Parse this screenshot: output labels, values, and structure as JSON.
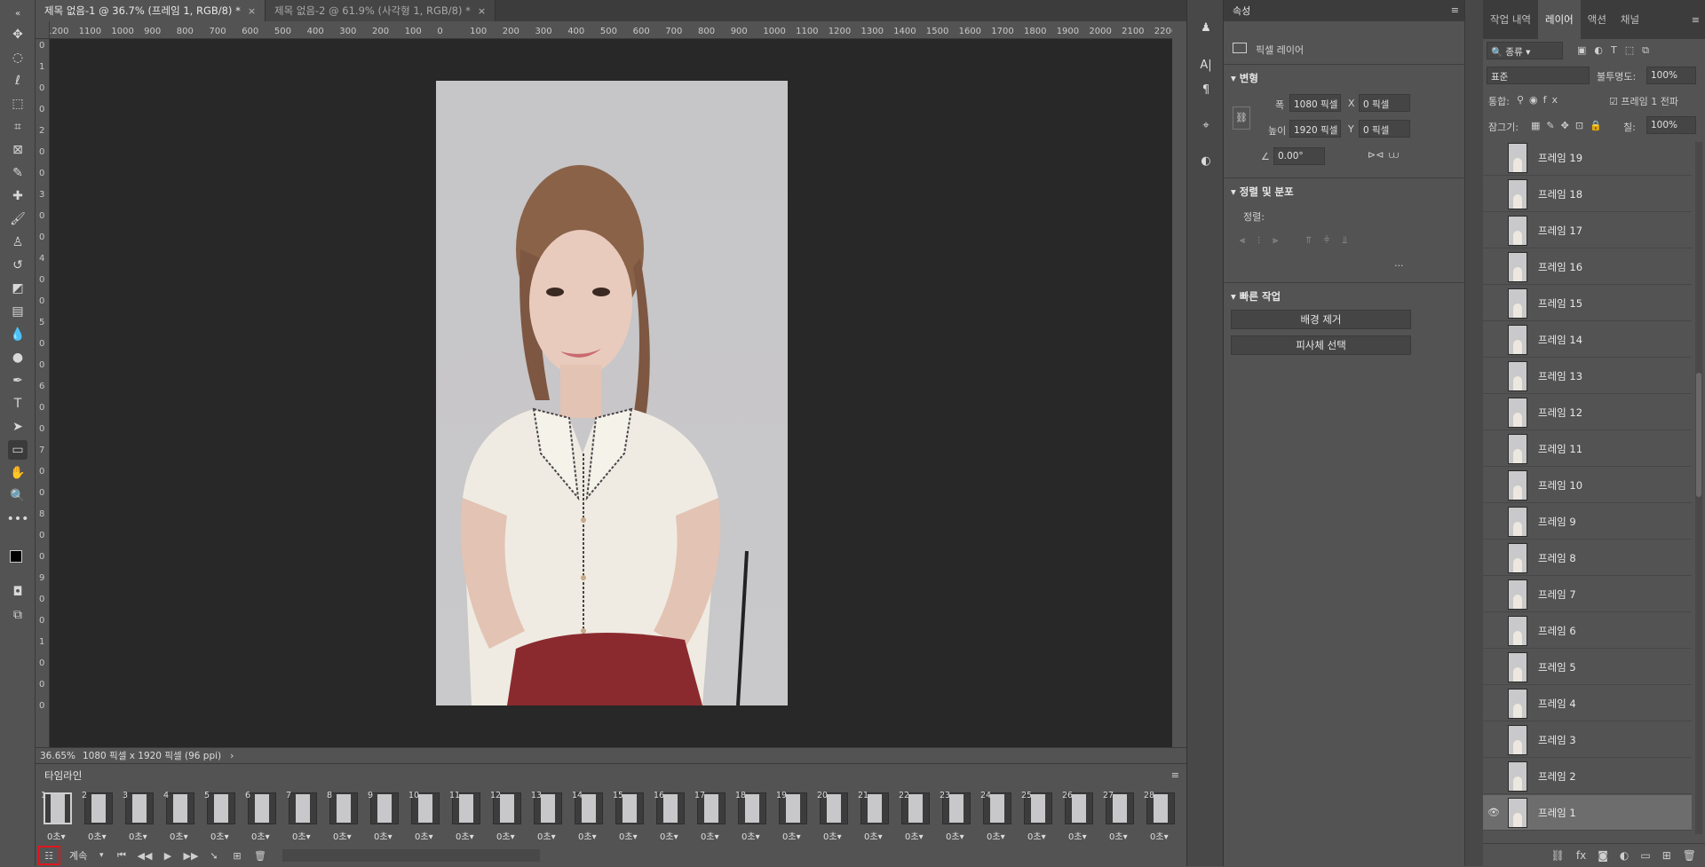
{
  "documents": {
    "tabs": [
      {
        "label": "제목 없음-1 @ 36.7% (프레임 1, RGB/8) *",
        "close": "×"
      },
      {
        "label": "제목 없음-2 @ 61.9% (사각형 1, RGB/8) *",
        "close": "×"
      }
    ]
  },
  "ruler": {
    "h_ticks": [
      "1200",
      "1100",
      "1000",
      "900",
      "800",
      "700",
      "600",
      "500",
      "400",
      "300",
      "200",
      "100",
      "0",
      "100",
      "200",
      "300",
      "400",
      "500",
      "600",
      "700",
      "800",
      "900",
      "1000",
      "1100",
      "1200",
      "1300",
      "1400",
      "1500",
      "1600",
      "1700",
      "1800",
      "1900",
      "2000",
      "2100",
      "2200"
    ],
    "v_ticks": [
      "0",
      "1",
      "0",
      "0",
      "2",
      "0",
      "0",
      "3",
      "0",
      "0",
      "4",
      "0",
      "0",
      "5",
      "0",
      "0",
      "6",
      "0",
      "0",
      "7",
      "0",
      "0",
      "8",
      "0",
      "0",
      "9",
      "0",
      "0",
      "1",
      "0",
      "0",
      "0"
    ]
  },
  "status": {
    "zoom": "36.65%",
    "info": "1080 픽셀 x 1920 픽셀 (96 ppi)",
    "arrow": "›"
  },
  "timeline": {
    "title": "타임라인",
    "frames": [
      "1",
      "2",
      "3",
      "4",
      "5",
      "6",
      "7",
      "8",
      "9",
      "10",
      "11",
      "12",
      "13",
      "14",
      "15",
      "16",
      "17",
      "18",
      "19",
      "20",
      "21",
      "22",
      "23",
      "24",
      "25",
      "26",
      "27",
      "28"
    ],
    "delay": "0초",
    "loop": "계속",
    "selected_frame": "1"
  },
  "properties": {
    "tab": "속성",
    "layer_type": "픽셀 레이어",
    "transform": {
      "title": "변형",
      "width_label": "폭",
      "width": "1080 픽셀",
      "height_label": "높이",
      "height": "1920 픽셀",
      "x_label": "X",
      "x": "0 픽셀",
      "y_label": "Y",
      "y": "0 픽셀",
      "angle": "0.00°"
    },
    "align": {
      "title": "정렬 및 분포",
      "label": "정렬:",
      "more": "..."
    },
    "quick": {
      "title": "빠른 작업",
      "remove_bg": "배경 제거",
      "select_subject": "피사체 선택"
    }
  },
  "layers_panel": {
    "tabs": [
      "작업 내역",
      "레이어",
      "액션",
      "채널"
    ],
    "active_tab": "레이어",
    "filter_kind": "종류",
    "blend_mode": "표준",
    "opacity_label": "불투명도:",
    "opacity": "100%",
    "unify_label": "통합:",
    "propagate": "프레임 1 전파",
    "lock_label": "잠그기:",
    "fill_label": "칠:",
    "fill": "100%",
    "layers": [
      "프레임 19",
      "프레임 18",
      "프레임 17",
      "프레임 16",
      "프레임 15",
      "프레임 14",
      "프레임 13",
      "프레임 12",
      "프레임 11",
      "프레임 10",
      "프레임 9",
      "프레임 8",
      "프레임 7",
      "프레임 6",
      "프레임 5",
      "프레임 4",
      "프레임 3",
      "프레임 2",
      "프레임 1"
    ],
    "active_layer": "프레임 1"
  }
}
